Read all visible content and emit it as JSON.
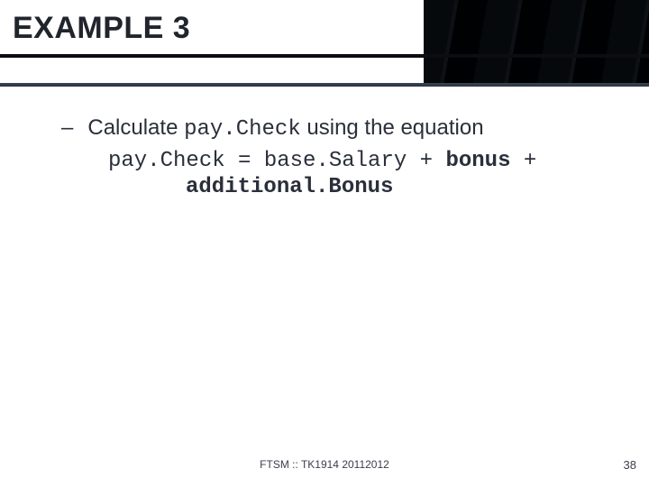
{
  "header": {
    "title": "EXAMPLE 3"
  },
  "content": {
    "bullet_dash": "–",
    "bullet_text_pre": "Calculate ",
    "bullet_code": "pay.Check",
    "bullet_text_post": " using the equation",
    "eq_lhs": "pay.Check = base.Salary + ",
    "eq_bonus": "bonus",
    "eq_plus": " +",
    "eq_line2": "additional.Bonus"
  },
  "footer": {
    "center": "FTSM :: TK1914 20112012",
    "page": "38"
  }
}
